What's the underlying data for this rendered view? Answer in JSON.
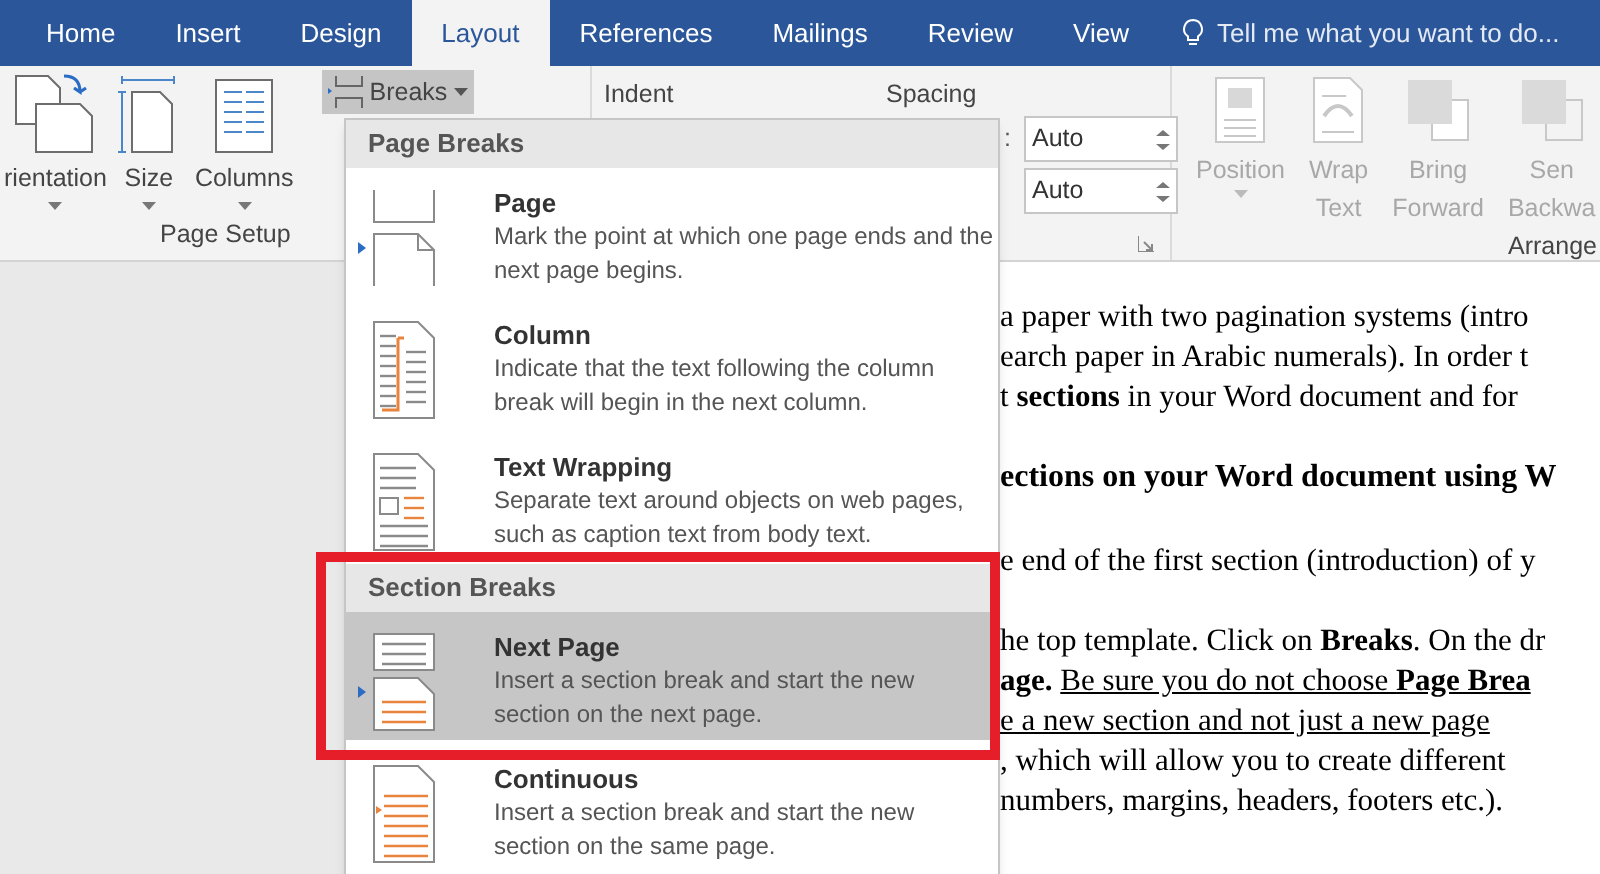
{
  "tabs": [
    {
      "label": "Home",
      "selected": false
    },
    {
      "label": "Insert",
      "selected": false
    },
    {
      "label": "Design",
      "selected": false
    },
    {
      "label": "Layout",
      "selected": true
    },
    {
      "label": "References",
      "selected": false
    },
    {
      "label": "Mailings",
      "selected": false
    },
    {
      "label": "Review",
      "selected": false
    },
    {
      "label": "View",
      "selected": false
    }
  ],
  "tell_me": {
    "placeholder": "Tell me what you want to do..."
  },
  "page_setup": {
    "buttons": [
      {
        "kind": "orientation",
        "label": "rientation"
      },
      {
        "kind": "size",
        "label": "Size"
      },
      {
        "kind": "columns",
        "label": "Columns"
      }
    ],
    "breaks": {
      "label": "Breaks",
      "expanded": true
    },
    "group_label": "Page Setup"
  },
  "paragraph": {
    "indent_label": "Indent",
    "spacing_label": "Spacing",
    "spacing_fields": [
      {
        "label": ":",
        "value": "Auto"
      },
      {
        "value": "Auto"
      }
    ]
  },
  "arrange": {
    "buttons": [
      {
        "kind": "position",
        "lines": [
          "Position"
        ],
        "disabled": true
      },
      {
        "kind": "wrap",
        "lines": [
          "Wrap",
          "Text"
        ],
        "disabled": true
      },
      {
        "kind": "bring",
        "lines": [
          "Bring",
          "Forward"
        ],
        "disabled": true
      },
      {
        "kind": "send",
        "lines": [
          "Sen",
          "Backwa"
        ],
        "disabled": true
      }
    ],
    "group_label": "Arrange"
  },
  "menu": {
    "sections": [
      {
        "title": "Page Breaks",
        "items": [
          {
            "kind": "page",
            "label": "Page",
            "description": "Mark the point at which one page ends and the next page begins.",
            "selected": false
          },
          {
            "kind": "column",
            "label": "Column",
            "description": "Indicate that the text following the column break will begin in the next column.",
            "selected": false
          },
          {
            "kind": "text-wrapping",
            "label": "Text Wrapping",
            "description": "Separate text around objects on web pages, such as caption text from body text.",
            "selected": false
          }
        ]
      },
      {
        "title": "Section Breaks",
        "items": [
          {
            "kind": "next-page",
            "label": "Next Page",
            "description": "Insert a section break and start the new section on the next page.",
            "selected": true
          },
          {
            "kind": "continuous",
            "label": "Continuous",
            "description": "Insert a section break and start the new section on the same page.",
            "selected": false
          }
        ]
      }
    ]
  },
  "document": {
    "paragraphs": [
      {
        "kind": "body",
        "lines": [
          {
            "text": "a paper with two pagination systems (intro"
          },
          {
            "text": "earch paper in Arabic numerals).  In order t"
          },
          {
            "text": "t **sections** in your Word document and for"
          }
        ]
      },
      {
        "kind": "heading",
        "lines": [
          {
            "text": "ections on your Word document using W"
          }
        ]
      },
      {
        "kind": "body",
        "lines": [
          {
            "text": "e end of the first section (introduction) of y"
          }
        ]
      },
      {
        "kind": "body",
        "lines": [
          {
            "text": "he top template. Click on **Breaks**. On the dr"
          },
          {
            "text": "**age.**",
            "underlined_text": "Be sure you do not choose **Page Brea**"
          },
          {
            "underlined_text": "e a new section and not just a new page"
          },
          {
            "text": ", which will allow you to create different"
          },
          {
            "text": "numbers, margins, headers, footers etc.)."
          }
        ]
      }
    ]
  }
}
